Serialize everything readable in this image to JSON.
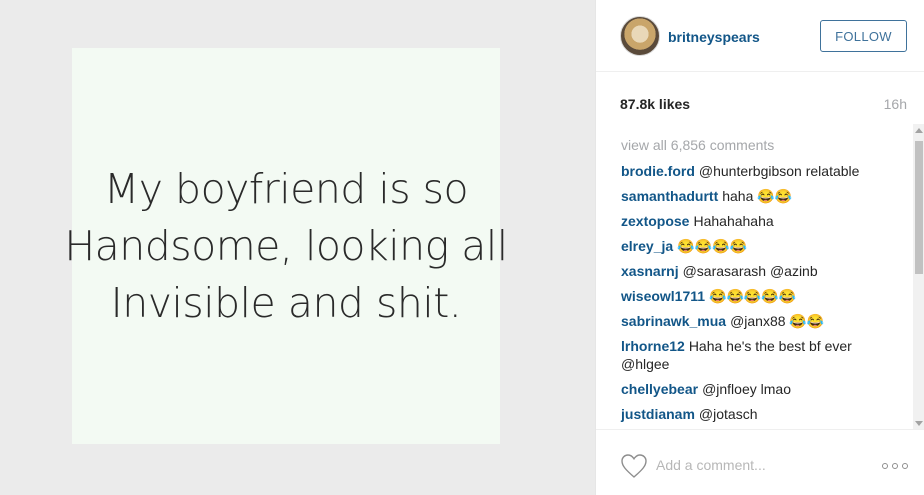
{
  "post": {
    "image_text": {
      "line1": "My boyfriend is so",
      "line2": "Handsome, looking all",
      "line3": "Invisible and shit."
    }
  },
  "header": {
    "username": "britneyspears",
    "follow_label": "FOLLOW"
  },
  "stats": {
    "likes": "87.8k likes",
    "age": "16h"
  },
  "comments": {
    "view_all": "view all 6,856 comments",
    "items": [
      {
        "author": "brodie.ford",
        "text": "@hunterbgibson relatable"
      },
      {
        "author": "samanthadurtt",
        "text": "haha 😂😂"
      },
      {
        "author": "zextopose",
        "text": "Hahahahaha"
      },
      {
        "author": "elrey_ja",
        "text": "😂😂😂😂"
      },
      {
        "author": "xasnarnj",
        "text": "@sarasarash @azinb"
      },
      {
        "author": "wiseowl1711",
        "text": "😂😂😂😂😂"
      },
      {
        "author": "sabrinawk_mua",
        "text": "@janx88 😂😂"
      },
      {
        "author": "lrhorne12",
        "text": "Haha he's the best bf ever @hlgee"
      },
      {
        "author": "chellyebear",
        "text": "@jnfloey lmao"
      },
      {
        "author": "justdianam",
        "text": "@jotasch"
      }
    ]
  },
  "footer": {
    "comment_placeholder": "Add a comment...",
    "like_icon": "heart-icon",
    "more_icon": "more-options-icon"
  },
  "colors": {
    "link": "#125688",
    "follow_border": "#3f729b",
    "muted": "#a5a7aa"
  }
}
